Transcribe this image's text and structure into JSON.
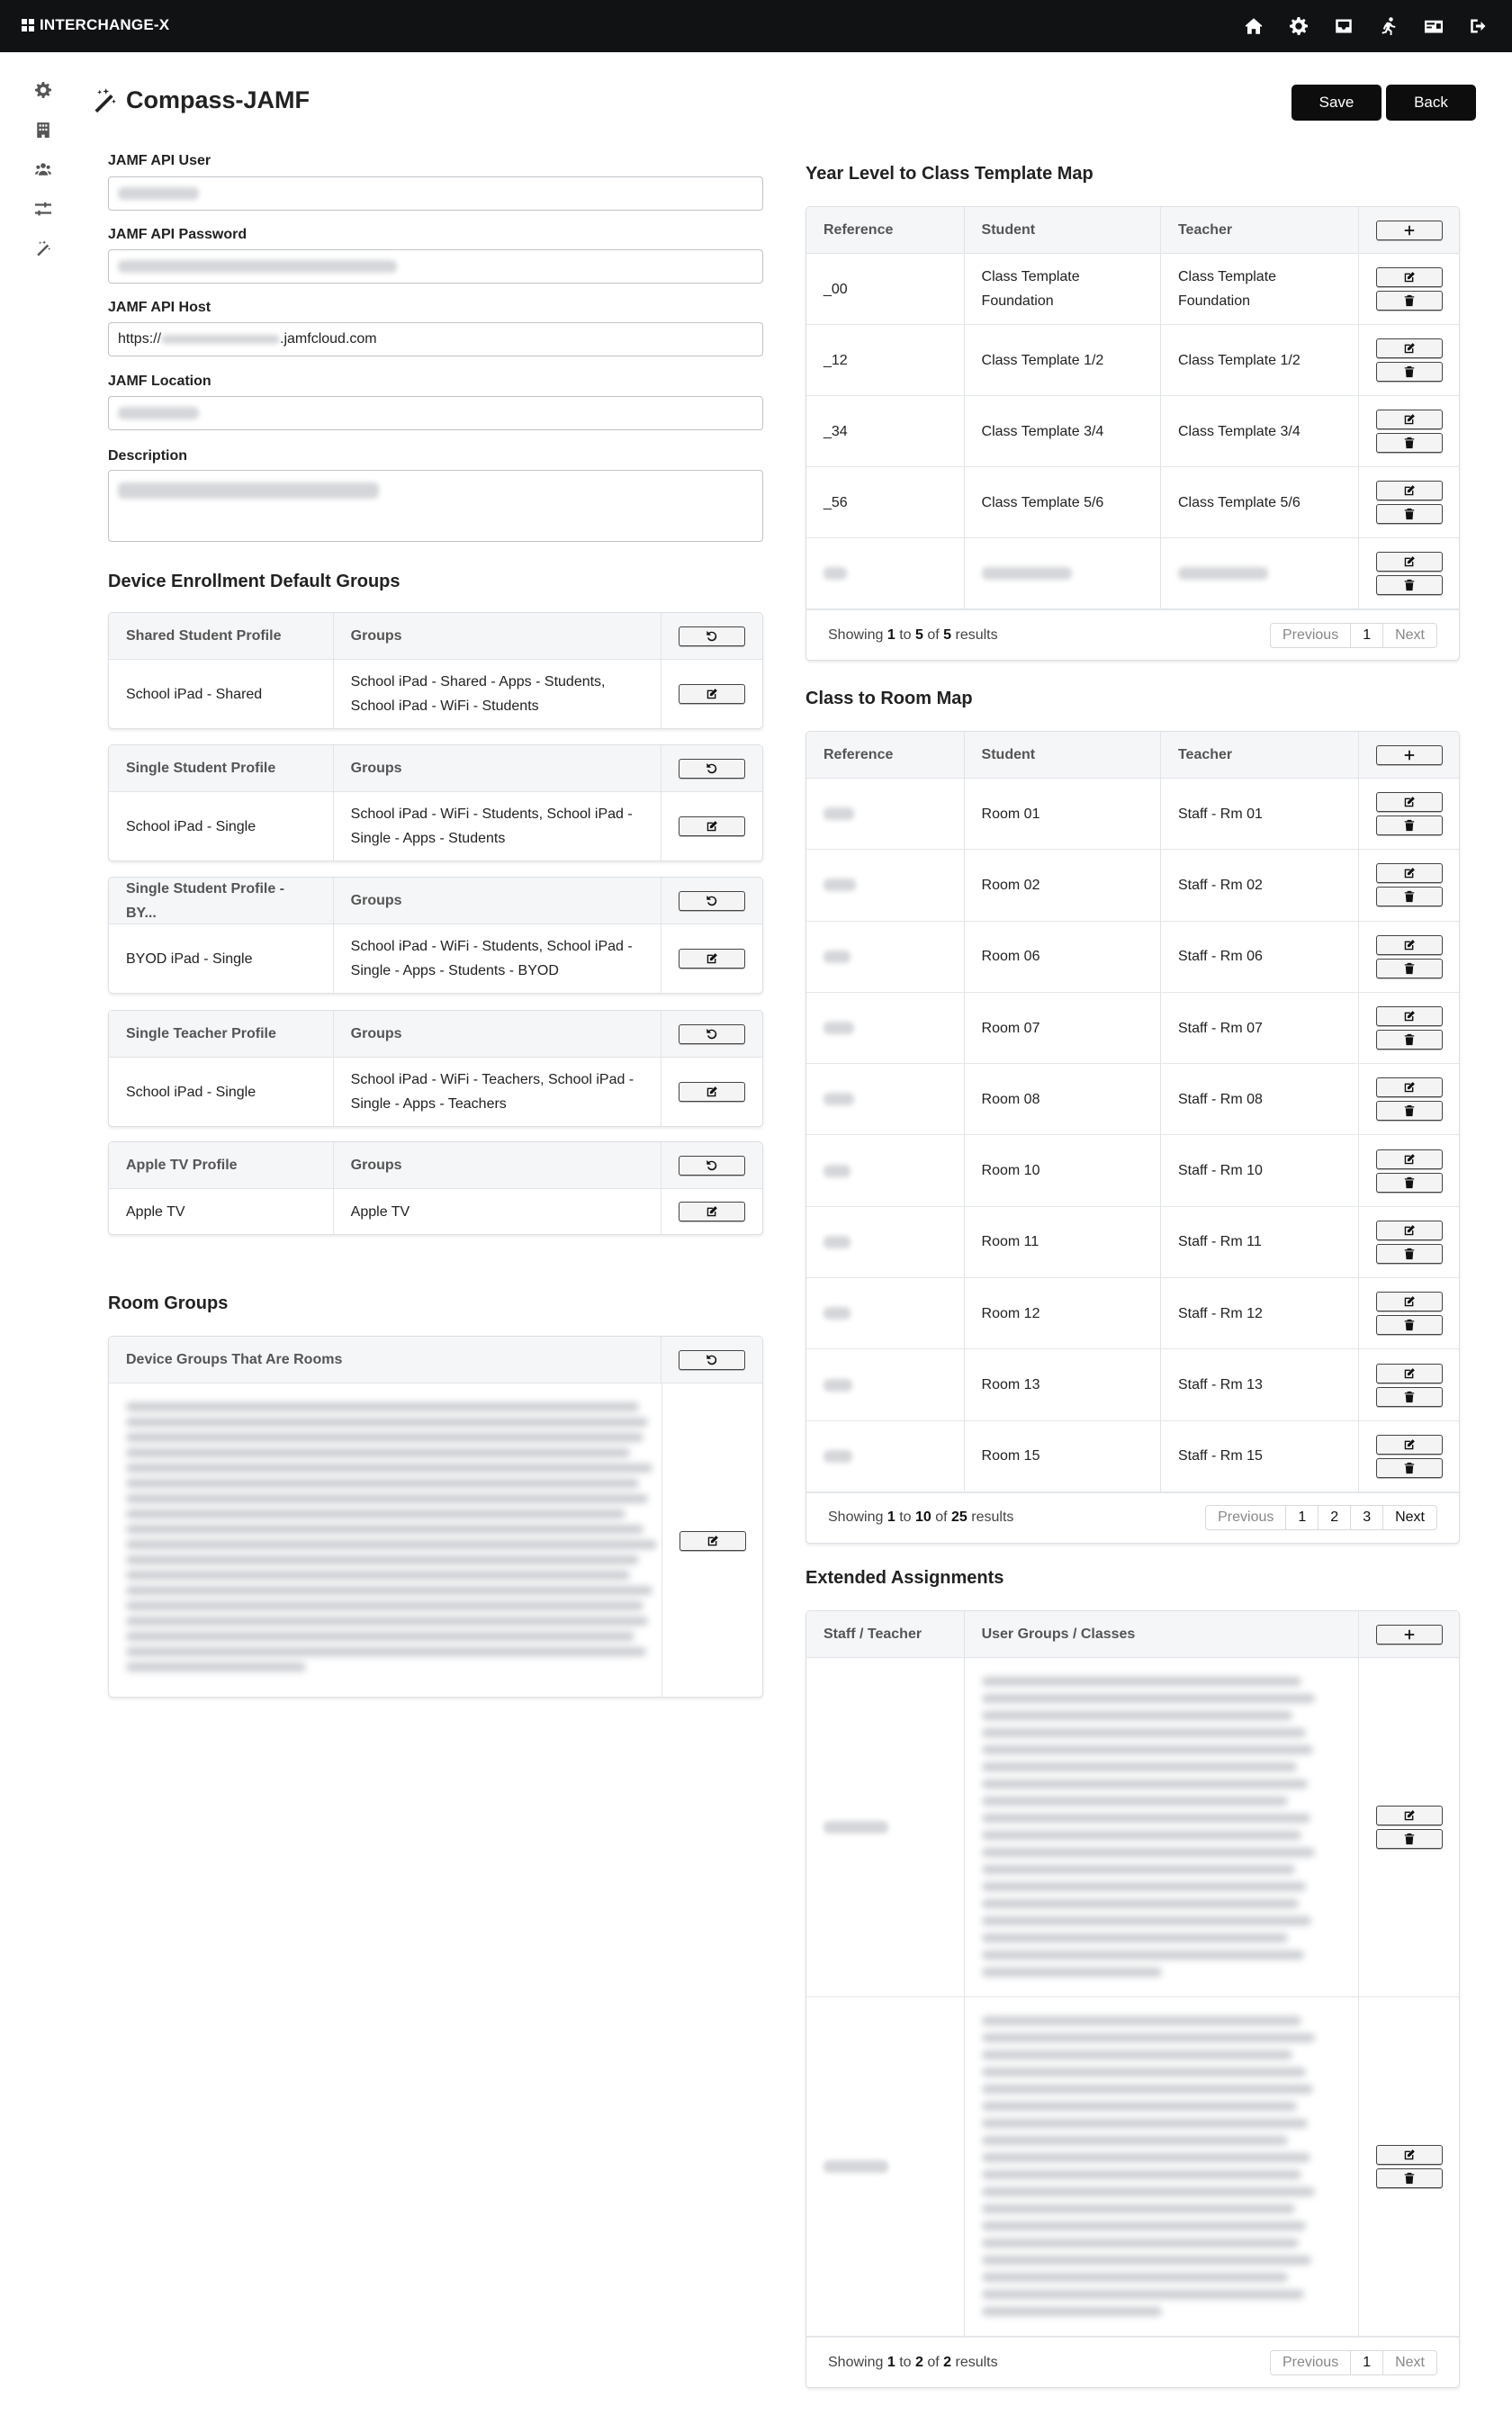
{
  "app": {
    "brand": "INTERCHANGE-X"
  },
  "page": {
    "title": "Compass-JAMF"
  },
  "header_buttons": {
    "save": "Save",
    "back": "Back"
  },
  "form": {
    "api_user_label": "JAMF API User",
    "api_password_label": "JAMF API Password",
    "api_host_label": "JAMF API Host",
    "api_host_prefix": "https://",
    "api_host_suffix": ".jamfcloud.com",
    "location_label": "JAMF Location",
    "description_label": "Description"
  },
  "enrollment": {
    "title": "Device Enrollment Default Groups",
    "groups_header": "Groups",
    "cards": [
      {
        "profile": "Shared Student Profile",
        "name": "School iPad - Shared",
        "groups": "School iPad - Shared - Apps - Students, School iPad - WiFi - Students"
      },
      {
        "profile": "Single Student Profile",
        "name": "School iPad - Single",
        "groups": "School iPad - WiFi - Students, School iPad - Single - Apps - Students"
      },
      {
        "profile": "Single Student Profile - BY...",
        "name": "BYOD iPad - Single",
        "groups": "School iPad - WiFi - Students, School iPad - Single - Apps - Students - BYOD"
      },
      {
        "profile": "Single Teacher Profile",
        "name": "School iPad - Single",
        "groups": "School iPad - WiFi - Teachers, School iPad - Single - Apps - Teachers"
      },
      {
        "profile": "Apple TV Profile",
        "name": "Apple TV",
        "groups": "Apple TV"
      }
    ]
  },
  "room_groups": {
    "title": "Room Groups",
    "header": "Device Groups That Are Rooms"
  },
  "year_level": {
    "title": "Year Level to Class Template Map",
    "headers": {
      "reference": "Reference",
      "student": "Student",
      "teacher": "Teacher"
    },
    "rows": [
      {
        "ref": "_00",
        "student": "Class Template Foundation",
        "teacher": "Class Template Foundation"
      },
      {
        "ref": "_12",
        "student": "Class Template 1/2",
        "teacher": "Class Template 1/2"
      },
      {
        "ref": "_34",
        "student": "Class Template 3/4",
        "teacher": "Class Template 3/4"
      },
      {
        "ref": "_56",
        "student": "Class Template 5/6",
        "teacher": "Class Template 5/6"
      }
    ],
    "footer": {
      "showing": "Showing",
      "from": "1",
      "to_word": "to",
      "to": "5",
      "of_word": "of",
      "total": "5",
      "results": "results"
    },
    "pager": {
      "previous": "Previous",
      "pages": [
        "1"
      ],
      "next": "Next"
    }
  },
  "class_room": {
    "title": "Class to Room Map",
    "headers": {
      "reference": "Reference",
      "student": "Student",
      "teacher": "Teacher"
    },
    "rows": [
      {
        "student": "Room 01",
        "teacher": "Staff - Rm 01"
      },
      {
        "student": "Room 02",
        "teacher": "Staff - Rm 02"
      },
      {
        "student": "Room 06",
        "teacher": "Staff - Rm 06"
      },
      {
        "student": "Room 07",
        "teacher": "Staff - Rm 07"
      },
      {
        "student": "Room 08",
        "teacher": "Staff - Rm 08"
      },
      {
        "student": "Room 10",
        "teacher": "Staff - Rm 10"
      },
      {
        "student": "Room 11",
        "teacher": "Staff - Rm 11"
      },
      {
        "student": "Room 12",
        "teacher": "Staff - Rm 12"
      },
      {
        "student": "Room 13",
        "teacher": "Staff - Rm 13"
      },
      {
        "student": "Room 15",
        "teacher": "Staff - Rm 15"
      }
    ],
    "footer": {
      "showing": "Showing",
      "from": "1",
      "to_word": "to",
      "to": "10",
      "of_word": "of",
      "total": "25",
      "results": "results"
    },
    "pager": {
      "previous": "Previous",
      "pages": [
        "1",
        "2",
        "3"
      ],
      "next": "Next"
    }
  },
  "extended": {
    "title": "Extended Assignments",
    "headers": {
      "staff": "Staff / Teacher",
      "groups": "User Groups / Classes"
    },
    "footer": {
      "showing": "Showing",
      "from": "1",
      "to_word": "to",
      "to": "2",
      "of_word": "of",
      "total": "2",
      "results": "results"
    },
    "pager": {
      "previous": "Previous",
      "pages": [
        "1"
      ],
      "next": "Next"
    }
  },
  "icons": {
    "top": [
      "home-icon",
      "gear-icon",
      "inbox-icon",
      "running-icon",
      "id-card-icon",
      "sign-out-icon"
    ],
    "sidebar": [
      "gear-icon",
      "building-icon",
      "users-icon",
      "sliders-icon",
      "magic-wand-icon"
    ]
  }
}
